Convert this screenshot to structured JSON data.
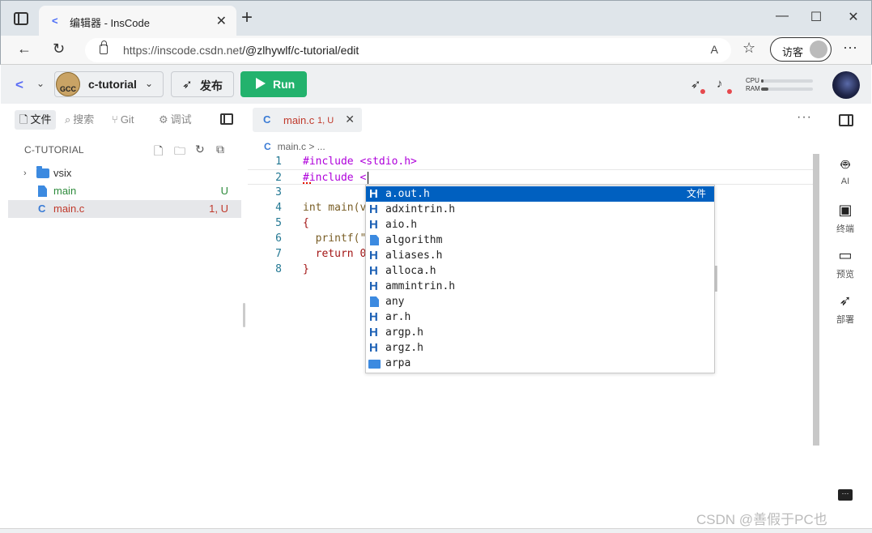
{
  "browser": {
    "tab_title": "编辑器 - InsCode",
    "url_host": "https://inscode.csdn.net",
    "url_path": "/@zlhywlf/c-tutorial/edit",
    "guest_label": "访客",
    "read_aloud": "A",
    "new_tab": "+",
    "close": "✕",
    "minimize": "—",
    "maximize": "☐"
  },
  "toolbar": {
    "project_name": "c-tutorial",
    "avatar_text": "GCC",
    "publish_label": "发布",
    "run_label": "Run",
    "cpu_label": "CPU",
    "ram_label": "RAM",
    "cpu_usage": 0.04,
    "ram_usage": 0.14
  },
  "left_panel": {
    "tabs": [
      {
        "icon": "🗋",
        "label": "文件"
      },
      {
        "icon": "⌕",
        "label": "搜索"
      },
      {
        "icon": "⑂",
        "label": "Git"
      },
      {
        "icon": "⚙",
        "label": "调试"
      }
    ],
    "explorer_title": "C-TUTORIAL",
    "tree": [
      {
        "label": "vsix",
        "type": "folder",
        "status": ""
      },
      {
        "label": "main",
        "type": "file",
        "status": "U"
      },
      {
        "label": "main.c",
        "type": "c",
        "status": "1, U"
      }
    ]
  },
  "editor": {
    "tab_label": "main.c",
    "tab_status": "1, U",
    "breadcrumb_file": "main.c",
    "breadcrumb_rest": "> ...",
    "more": "···",
    "lines": [
      {
        "n": "1",
        "code": "#include <stdio.h>"
      },
      {
        "n": "2",
        "code": "#include <"
      },
      {
        "n": "3",
        "code": ""
      },
      {
        "n": "4",
        "code": "int main(v"
      },
      {
        "n": "5",
        "code": "{"
      },
      {
        "n": "6",
        "code": "  printf(\""
      },
      {
        "n": "7",
        "code": "  return 0"
      },
      {
        "n": "8",
        "code": "}"
      }
    ]
  },
  "suggestions": {
    "active_kind": "文件",
    "items": [
      {
        "label": "a.out.h",
        "icon": "H"
      },
      {
        "label": "adxintrin.h",
        "icon": "H"
      },
      {
        "label": "aio.h",
        "icon": "H"
      },
      {
        "label": "algorithm",
        "icon": "file"
      },
      {
        "label": "aliases.h",
        "icon": "H"
      },
      {
        "label": "alloca.h",
        "icon": "H"
      },
      {
        "label": "ammintrin.h",
        "icon": "H"
      },
      {
        "label": "any",
        "icon": "file"
      },
      {
        "label": "ar.h",
        "icon": "H"
      },
      {
        "label": "argp.h",
        "icon": "H"
      },
      {
        "label": "argz.h",
        "icon": "H"
      },
      {
        "label": "arpa",
        "icon": "folder"
      }
    ]
  },
  "right_bar": {
    "items": [
      {
        "label": "AI",
        "icon": "robot-icon"
      },
      {
        "label": "终端",
        "icon": "terminal-icon"
      },
      {
        "label": "预览",
        "icon": "monitor-icon"
      },
      {
        "label": "部署",
        "icon": "rocket-icon"
      }
    ]
  },
  "watermark": "CSDN @善假于PC也"
}
